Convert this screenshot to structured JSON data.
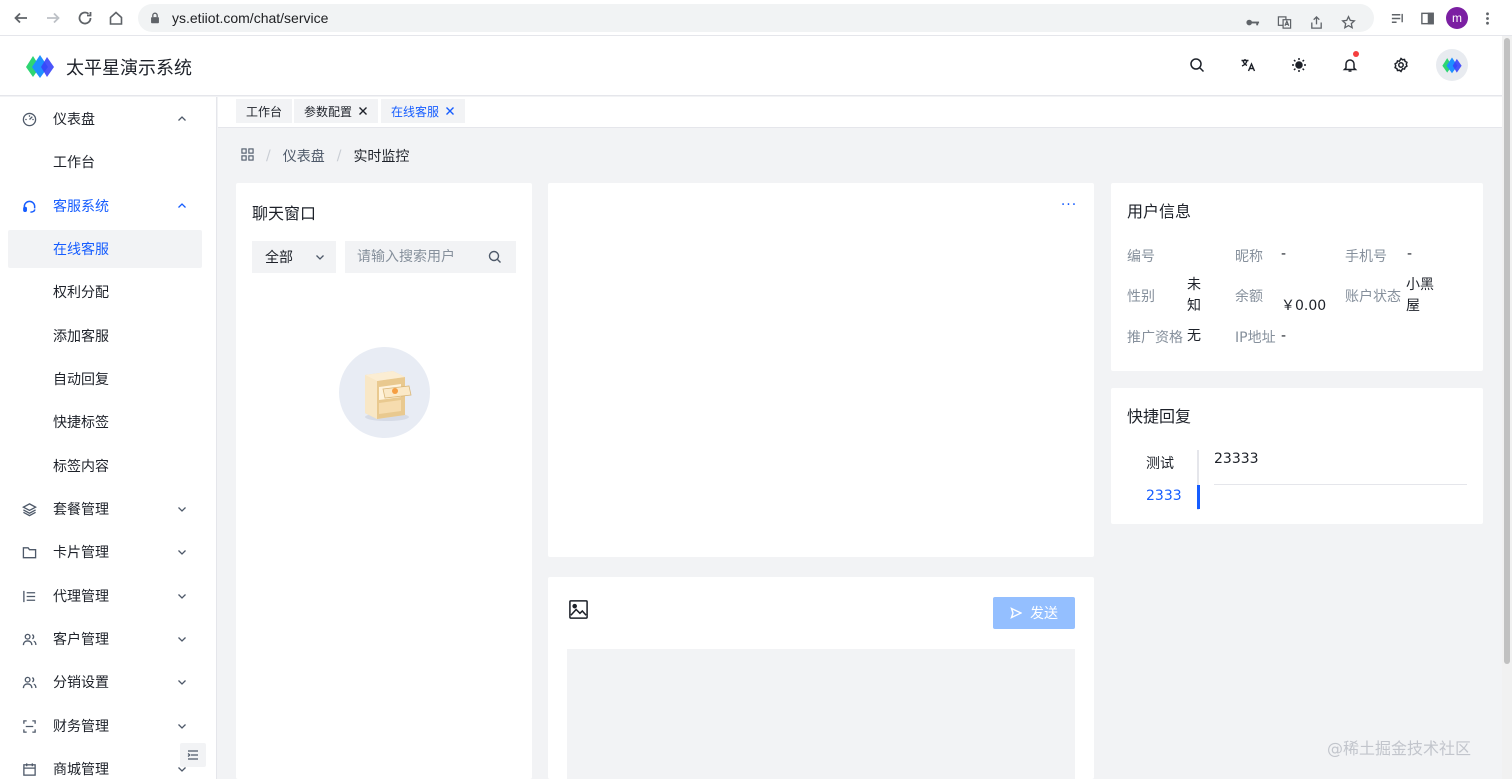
{
  "browser": {
    "url": "ys.etiiot.com/chat/service",
    "profile_initial": "m"
  },
  "app": {
    "title": "太平星演示系统",
    "header_icons": [
      "search-icon",
      "translate-icon",
      "theme-icon",
      "bell-icon",
      "gear-icon"
    ],
    "accent_color": "#165dff"
  },
  "sidebar": {
    "items": [
      {
        "label": "仪表盘",
        "icon": "dashboard-icon",
        "expanded": true
      },
      {
        "label": "工作台"
      },
      {
        "label": "客服系统",
        "icon": "headset-icon",
        "expanded": true
      },
      {
        "label": "在线客服",
        "selected": true
      },
      {
        "label": "权利分配"
      },
      {
        "label": "添加客服"
      },
      {
        "label": "自动回复"
      },
      {
        "label": "快捷标签"
      },
      {
        "label": "标签内容"
      },
      {
        "label": "套餐管理",
        "icon": "layers-icon"
      },
      {
        "label": "卡片管理",
        "icon": "folder-icon"
      },
      {
        "label": "代理管理",
        "icon": "list-icon"
      },
      {
        "label": "客户管理",
        "icon": "users-icon"
      },
      {
        "label": "分销设置",
        "icon": "users-icon"
      },
      {
        "label": "财务管理",
        "icon": "scan-icon"
      },
      {
        "label": "商城管理",
        "icon": "calendar-icon"
      }
    ]
  },
  "tabs": [
    {
      "label": "工作台"
    },
    {
      "label": "参数配置"
    },
    {
      "label": "在线客服",
      "active": true
    }
  ],
  "breadcrumb": {
    "items": [
      "仪表盘",
      "实时监控"
    ]
  },
  "chat_list": {
    "title": "聊天窗口",
    "filter_value": "全部",
    "search_placeholder": "请输入搜索用户"
  },
  "composer": {
    "send_label": "发送"
  },
  "user_info": {
    "title": "用户信息",
    "fields": {
      "id_label": "编号",
      "id_value": "",
      "nickname_label": "昵称",
      "nickname_value": "-",
      "phone_label": "手机号",
      "phone_value": "-",
      "gender_label": "性别",
      "gender_value": "未知",
      "balance_label": "余额",
      "balance_value": "￥0.00",
      "status_label": "账户状态",
      "status_value": "小黑屋",
      "promo_label": "推广资格",
      "promo_value": "无",
      "ip_label": "IP地址",
      "ip_value": "-"
    }
  },
  "quick_reply": {
    "title": "快捷回复",
    "tabs": [
      "测试",
      "2333"
    ],
    "active_tab_index": 1,
    "content": "23333"
  },
  "watermark": "@稀土掘金技术社区"
}
